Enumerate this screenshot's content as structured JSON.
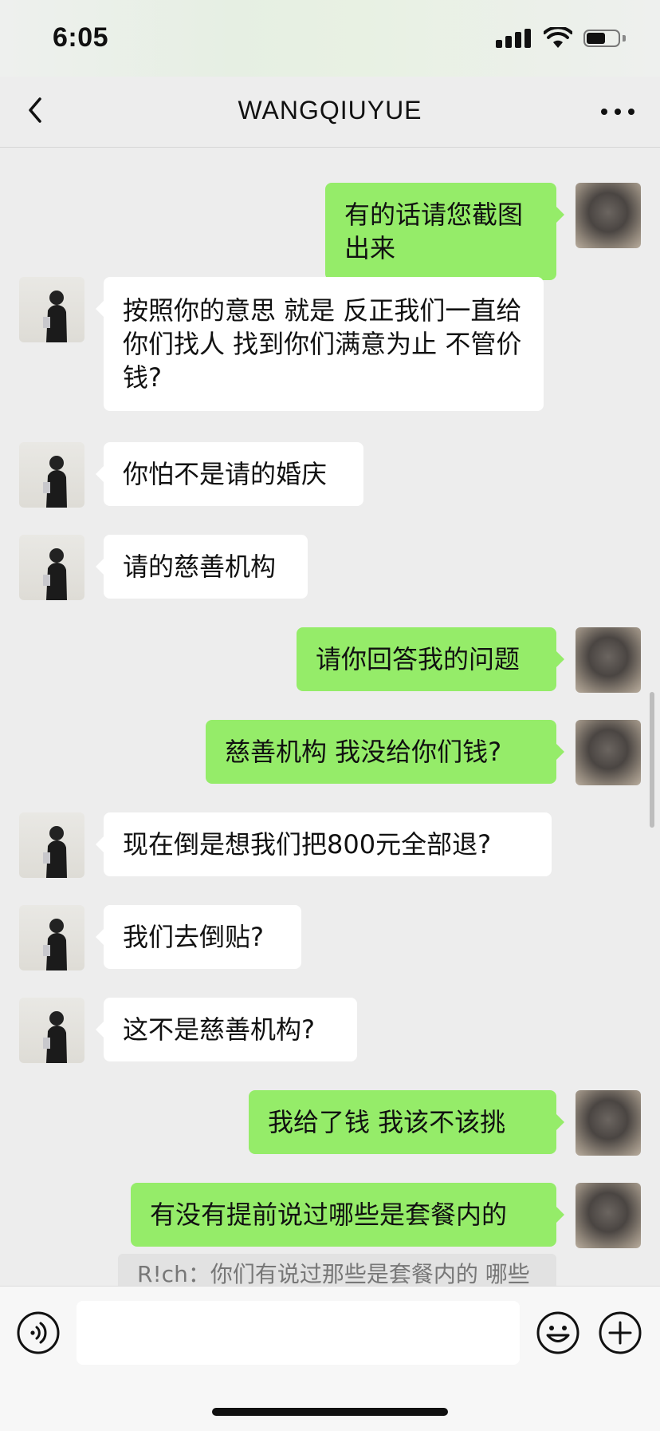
{
  "status": {
    "time": "6:05",
    "battery_level": 0.6
  },
  "header": {
    "title": "WANGQIUYUE",
    "back_icon": "chevron-left-icon",
    "more_icon": "ellipsis-icon"
  },
  "messages": [
    {
      "side": "right",
      "text": "有的话请您截图出来"
    },
    {
      "side": "left",
      "text": "按照你的意思 就是 反正我们一直给你们找人 找到你们满意为止 不管价钱?"
    },
    {
      "side": "left",
      "text": "你怕不是请的婚庆"
    },
    {
      "side": "left",
      "text": "请的慈善机构"
    },
    {
      "side": "right",
      "text": "请你回答我的问题"
    },
    {
      "side": "right",
      "text": "慈善机构  我没给你们钱?"
    },
    {
      "side": "left",
      "text": "现在倒是想我们把800元全部退?"
    },
    {
      "side": "left",
      "text": "我们去倒贴?"
    },
    {
      "side": "left",
      "text": "这不是慈善机构?"
    },
    {
      "side": "right",
      "text": "我给了钱  我该不该挑"
    },
    {
      "side": "right",
      "text": "有没有提前说过哪些是套餐内的"
    }
  ],
  "quote": {
    "text": "R!ch：你们有说过那些是套餐内的  哪些"
  },
  "input_bar": {
    "voice_icon": "voice-icon",
    "emoji_icon": "emoji-icon",
    "plus_icon": "plus-icon",
    "message_value": ""
  },
  "colors": {
    "background": "#ededed",
    "sent_bubble": "#95ec69",
    "received_bubble": "#ffffff"
  }
}
